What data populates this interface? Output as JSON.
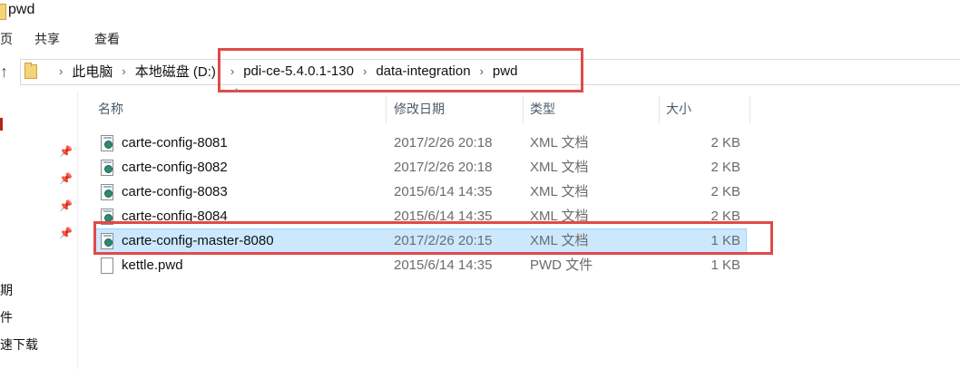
{
  "window": {
    "title": "pwd"
  },
  "ribbon": {
    "tabs": [
      "页",
      "共享",
      "查看"
    ]
  },
  "address_bar": {
    "crumbs": [
      "此电脑",
      "本地磁盘 (D:)",
      "pdi-ce-5.4.0.1-130",
      "data-integration",
      "pwd"
    ]
  },
  "nav_pane": {
    "items": [
      "期",
      "件",
      "速下载"
    ]
  },
  "columns": {
    "name": "名称",
    "date": "修改日期",
    "type": "类型",
    "size": "大小"
  },
  "files": [
    {
      "name": "carte-config-8081",
      "date": "2017/2/26 20:18",
      "type": "XML 文档",
      "size": "2 KB",
      "icon": "xml-file-icon"
    },
    {
      "name": "carte-config-8082",
      "date": "2017/2/26 20:18",
      "type": "XML 文档",
      "size": "2 KB",
      "icon": "xml-file-icon"
    },
    {
      "name": "carte-config-8083",
      "date": "2015/6/14 14:35",
      "type": "XML 文档",
      "size": "2 KB",
      "icon": "xml-file-icon"
    },
    {
      "name": "carte-config-8084",
      "date": "2015/6/14 14:35",
      "type": "XML 文档",
      "size": "2 KB",
      "icon": "xml-file-icon"
    },
    {
      "name": "carte-config-master-8080",
      "date": "2017/2/26 20:15",
      "type": "XML 文档",
      "size": "1 KB",
      "icon": "xml-file-icon",
      "selected": true
    },
    {
      "name": "kettle.pwd",
      "date": "2015/6/14 14:35",
      "type": "PWD 文件",
      "size": "1 KB",
      "icon": "generic-file-icon"
    }
  ],
  "colors": {
    "highlight_border": "#e04a4a",
    "selection_bg": "#cce8ff",
    "folder": "#f4d37a"
  },
  "icons": [
    "folder-icon",
    "up-arrow-icon",
    "chevron-right-icon",
    "pin-icon",
    "xml-file-icon",
    "generic-file-icon",
    "sort-caret-icon"
  ]
}
